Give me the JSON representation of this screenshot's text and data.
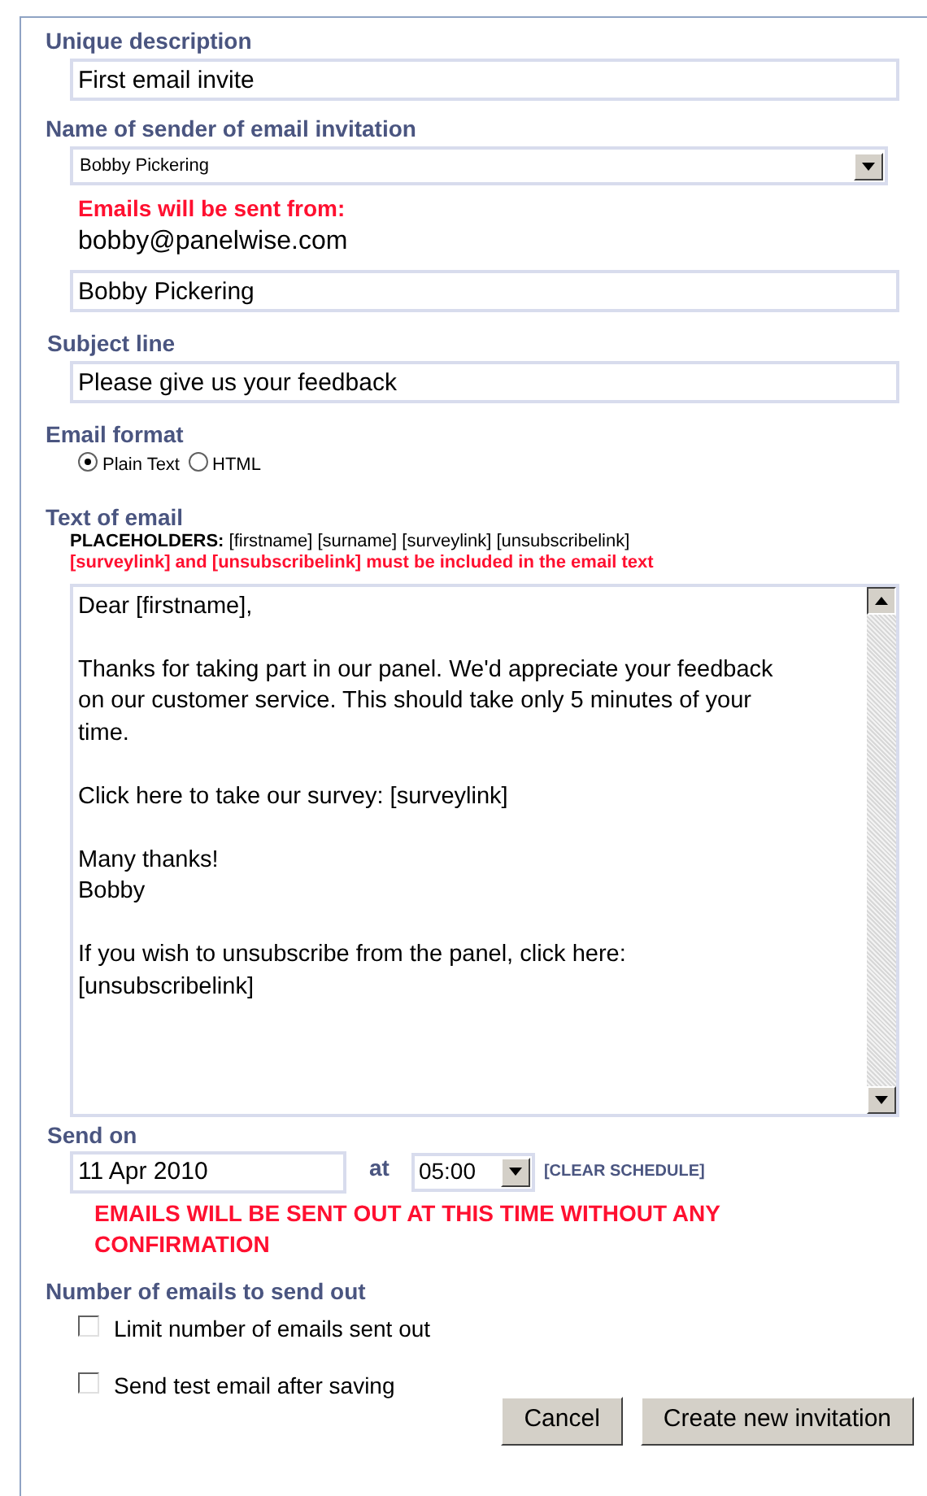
{
  "unique_description": {
    "label": "Unique description",
    "value": "First email invite"
  },
  "sender": {
    "label": "Name of sender of email invitation",
    "selected_value": "Bobby Pickering",
    "from_label": "Emails will be sent from:",
    "from_address": "bobby@panelwise.com",
    "display_name": "Bobby Pickering"
  },
  "subject": {
    "label": "Subject line",
    "value": "Please give us your feedback"
  },
  "email_format": {
    "label": "Email format",
    "options": [
      {
        "label": "Plain Text",
        "selected": true
      },
      {
        "label": "HTML",
        "selected": false
      }
    ]
  },
  "email_text": {
    "label": "Text of email",
    "placeholders": "**PLACEHOLDERS:** [firstname] [surname] [surveylink] [unsubscribelink]",
    "warning": "[surveylink] and [unsubscribelink] must be included in the email text",
    "body": "Dear [firstname],\n\nThanks for taking part in our panel. We'd appreciate your feedback\non our customer service. This should take only 5 minutes of your\ntime.\n\nClick here to take our survey: [surveylink]\n\nMany thanks!\nBobby\n\nIf you wish to unsubscribe from the panel, click here:\n[unsubscribelink]"
  },
  "send_on": {
    "label": "Send on",
    "date": "11 Apr 2010",
    "at_label": "at",
    "time": "05:00",
    "clear_link": "[CLEAR SCHEDULE]",
    "warning": "EMAILS WILL BE SENT OUT AT THIS TIME WITHOUT ANY CONFIRMATION"
  },
  "number_of_emails": {
    "label": "Number of emails to send out",
    "options": [
      {
        "label": "Limit number of emails sent out",
        "checked": false
      },
      {
        "label": "Send test email after saving",
        "checked": false
      }
    ]
  },
  "buttons": [
    {
      "label": "Cancel"
    },
    {
      "label": "Create new invitation"
    }
  ]
}
